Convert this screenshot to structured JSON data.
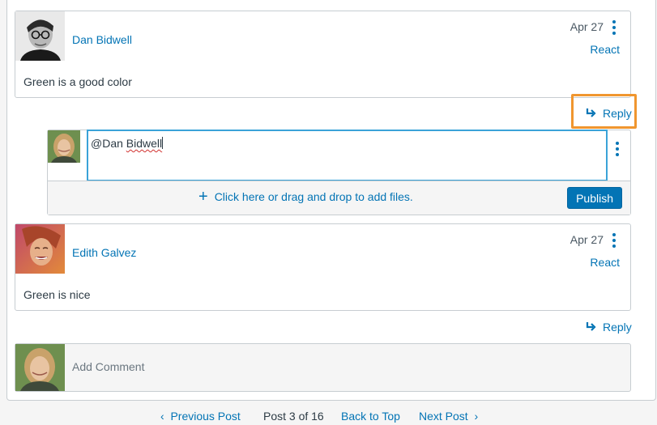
{
  "thread": [
    {
      "author": "Dan Bidwell",
      "date": "Apr 27",
      "react_label": "React",
      "message": "Green is a good color",
      "reply_label": "Reply",
      "avatar_icon": "man-with-glasses-avatar"
    },
    {
      "author": "Edith Galvez",
      "date": "Apr 27",
      "react_label": "React",
      "message": "Green is nice",
      "reply_label": "Reply",
      "avatar_icon": "woman-laughing-avatar"
    }
  ],
  "composer": {
    "mention_prefix": "@Dan ",
    "mention_name": "Bidwell",
    "add_files_label": "Click here or drag and drop to add files.",
    "publish_label": "Publish",
    "avatar_icon": "current-user-avatar"
  },
  "add_comment": {
    "placeholder": "Add Comment"
  },
  "pager": {
    "previous_label": "Previous Post",
    "position_label": "Post 3 of 16",
    "back_to_top_label": "Back to Top",
    "next_label": "Next Post"
  },
  "colors": {
    "link": "#0374b5",
    "highlight": "#f0962f",
    "editor_focus": "#3aa3d8"
  }
}
